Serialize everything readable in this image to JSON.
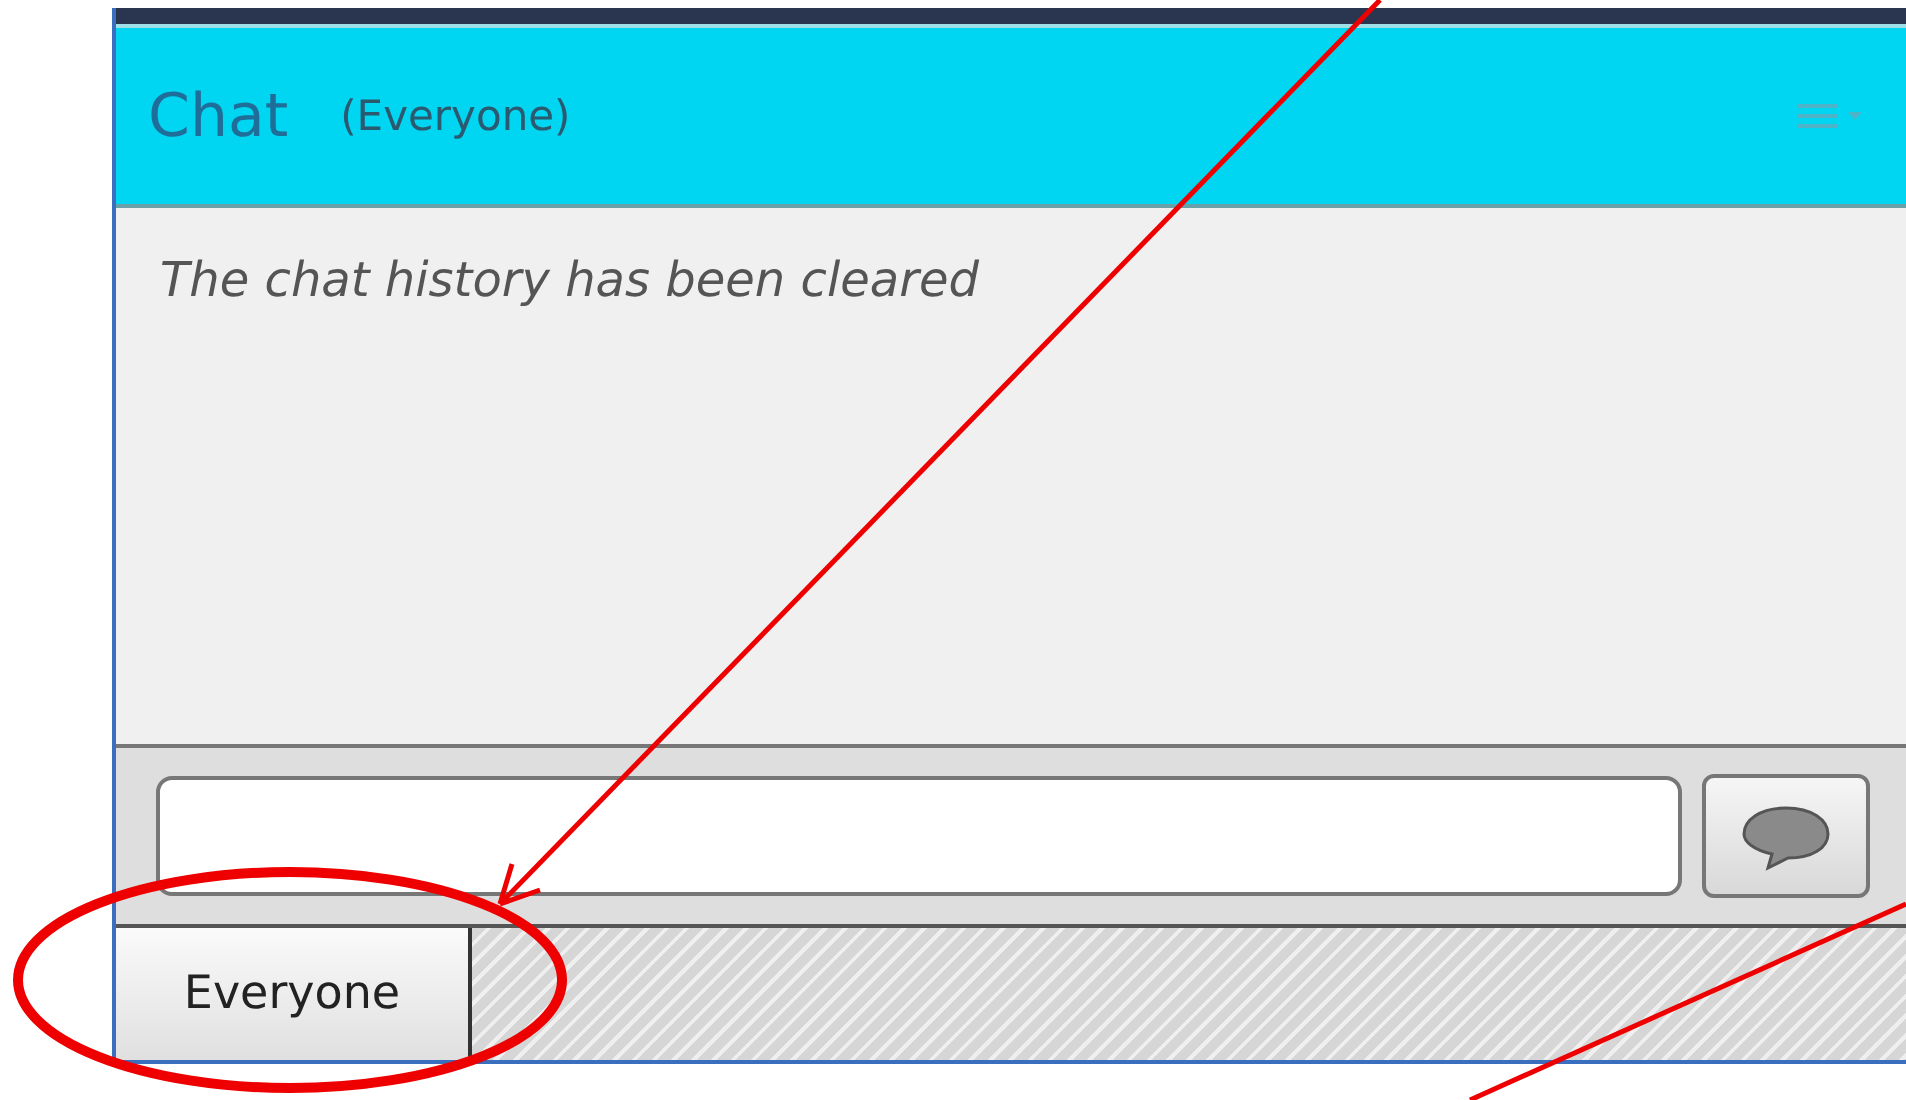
{
  "panel": {
    "title": "Chat",
    "audience": "(Everyone)"
  },
  "messages": [
    {
      "text": "The chat history has been cleared"
    }
  ],
  "tabs": [
    {
      "label": "Everyone",
      "selected": true
    }
  ]
}
